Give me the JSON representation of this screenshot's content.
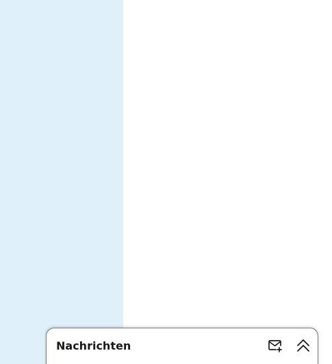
{
  "messaging": {
    "title": "Nachrichten",
    "icons": {
      "compose": "new-message-icon",
      "expand": "double-chevron-up-icon"
    }
  },
  "colors": {
    "left_panel": "#dff0fb",
    "main_background": "#ffffff",
    "bar_border": "#7a7a7a",
    "text": "#1a1a1a"
  }
}
